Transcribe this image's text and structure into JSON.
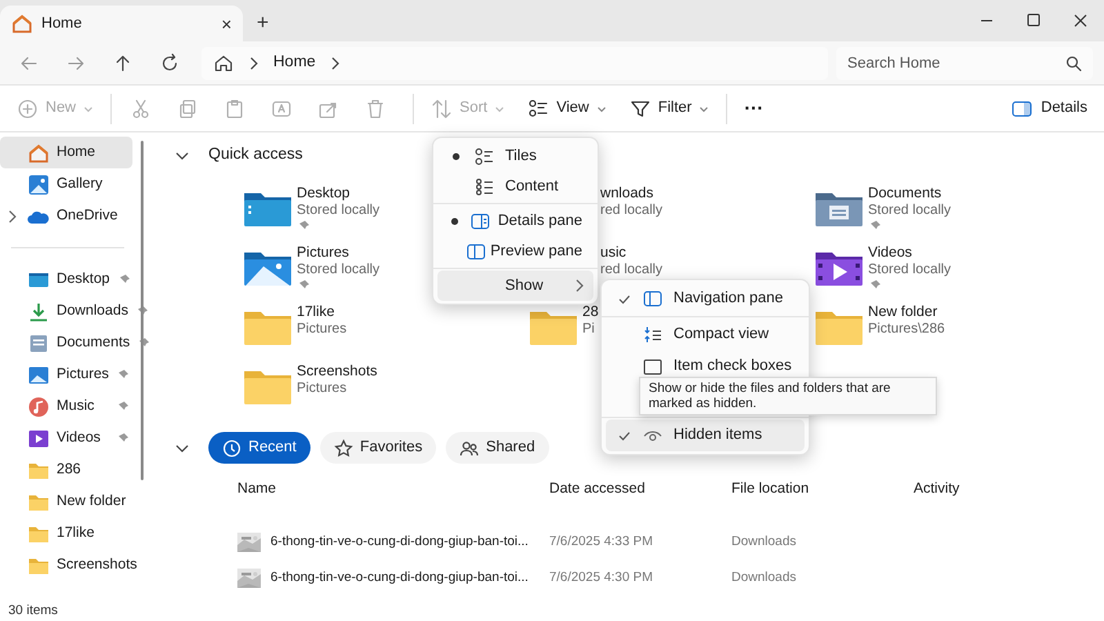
{
  "window": {
    "tab_title": "Home",
    "tab_close": "×",
    "new_tab": "+"
  },
  "address": {
    "path": [
      {
        "label": "Home"
      }
    ],
    "search_placeholder": "Search Home"
  },
  "toolbar": [
    {
      "kind": "new",
      "label": "New",
      "disabled": true
    },
    {
      "kind": "cut",
      "disabled": true
    },
    {
      "kind": "copy",
      "disabled": true
    },
    {
      "kind": "paste",
      "disabled": true
    },
    {
      "kind": "rename",
      "disabled": true
    },
    {
      "kind": "share",
      "disabled": true
    },
    {
      "kind": "delete",
      "disabled": true
    },
    {
      "kind": "sort",
      "label": "Sort",
      "disabled": true
    },
    {
      "kind": "view",
      "label": "View",
      "disabled": false
    },
    {
      "kind": "filter",
      "label": "Filter",
      "disabled": false
    },
    {
      "kind": "more",
      "label": "···",
      "disabled": false
    }
  ],
  "details_button": {
    "label": "Details"
  },
  "sidebar": {
    "top": [
      {
        "label": "Home",
        "kind": "leaf",
        "selected": true
      },
      {
        "label": "Gallery",
        "kind": "leaf",
        "selected": false
      },
      {
        "label": "OneDrive",
        "kind": "node",
        "selected": false
      }
    ],
    "pinned": [
      {
        "label": "Desktop",
        "pinned": true
      },
      {
        "label": "Downloads",
        "pinned": true
      },
      {
        "label": "Documents",
        "pinned": true
      },
      {
        "label": "Pictures",
        "pinned": true
      },
      {
        "label": "Music",
        "pinned": true
      },
      {
        "label": "Videos",
        "pinned": true
      },
      {
        "label": "286",
        "pinned": false
      },
      {
        "label": "New folder",
        "pinned": false
      },
      {
        "label": "17like",
        "pinned": false
      },
      {
        "label": "Screenshots",
        "pinned": false
      }
    ]
  },
  "quick_access": {
    "title": "Quick access",
    "expanded": true,
    "items": [
      {
        "name": "Desktop",
        "sub": "Stored locally",
        "pinned": true,
        "kind": "full"
      },
      {
        "name": "wnloads",
        "sub": "red locally",
        "pinned": false,
        "kind": "partial"
      },
      {
        "name": "Documents",
        "sub": "Stored locally",
        "pinned": true,
        "kind": "full"
      },
      {
        "name": "Pictures",
        "sub": "Stored locally",
        "pinned": true,
        "kind": "full"
      },
      {
        "name": "usic",
        "sub": "red locally",
        "pinned": false,
        "kind": "partial"
      },
      {
        "name": "Videos",
        "sub": "Stored locally",
        "pinned": true,
        "kind": "full"
      },
      {
        "name": "17like",
        "sub": "Pictures",
        "pinned": false,
        "kind": "full"
      },
      {
        "name": "28",
        "sub": "Pi",
        "pinned": false,
        "kind": "full"
      },
      {
        "name": "New folder",
        "sub": "Pictures\\286",
        "pinned": false,
        "kind": "full"
      },
      {
        "name": "Screenshots",
        "sub": "Pictures",
        "pinned": false,
        "kind": "full"
      }
    ]
  },
  "recent": {
    "expanded": true,
    "tabs": [
      {
        "label": "Recent",
        "selected": true
      },
      {
        "label": "Favorites",
        "selected": false
      },
      {
        "label": "Shared",
        "selected": false
      }
    ],
    "columns": [
      "Name",
      "Date accessed",
      "File location",
      "Activity"
    ],
    "rows": [
      {
        "name": "6-thong-tin-ve-o-cung-di-dong-giup-ban-toi...",
        "date": "7/6/2025 4:33 PM",
        "location": "Downloads"
      },
      {
        "name": "6-thong-tin-ve-o-cung-di-dong-giup-ban-toi...",
        "date": "7/6/2025 4:30 PM",
        "location": "Downloads"
      }
    ]
  },
  "view_menu": {
    "items": [
      {
        "label": "Tiles",
        "kind": "radio",
        "selected": true
      },
      {
        "label": "Content",
        "kind": "radio",
        "selected": false
      },
      {
        "kind": "separator"
      },
      {
        "label": "Details pane",
        "kind": "radio",
        "selected": true
      },
      {
        "label": "Preview pane",
        "kind": "radio",
        "selected": false
      },
      {
        "kind": "separator"
      },
      {
        "label": "Show",
        "kind": "submenu",
        "selected": true
      }
    ]
  },
  "show_menu": {
    "items": [
      {
        "label": "Navigation pane",
        "checked": true,
        "hovered": false
      },
      {
        "label": "Compact view",
        "checked": false,
        "hovered": false
      },
      {
        "label": "Item check boxes",
        "checked": false,
        "hovered": false
      },
      {
        "label": "Hidden items",
        "checked": true,
        "hovered": true
      }
    ]
  },
  "tooltip": "Show or hide the files and folders that are marked as hidden.",
  "status_bar": "30 items"
}
